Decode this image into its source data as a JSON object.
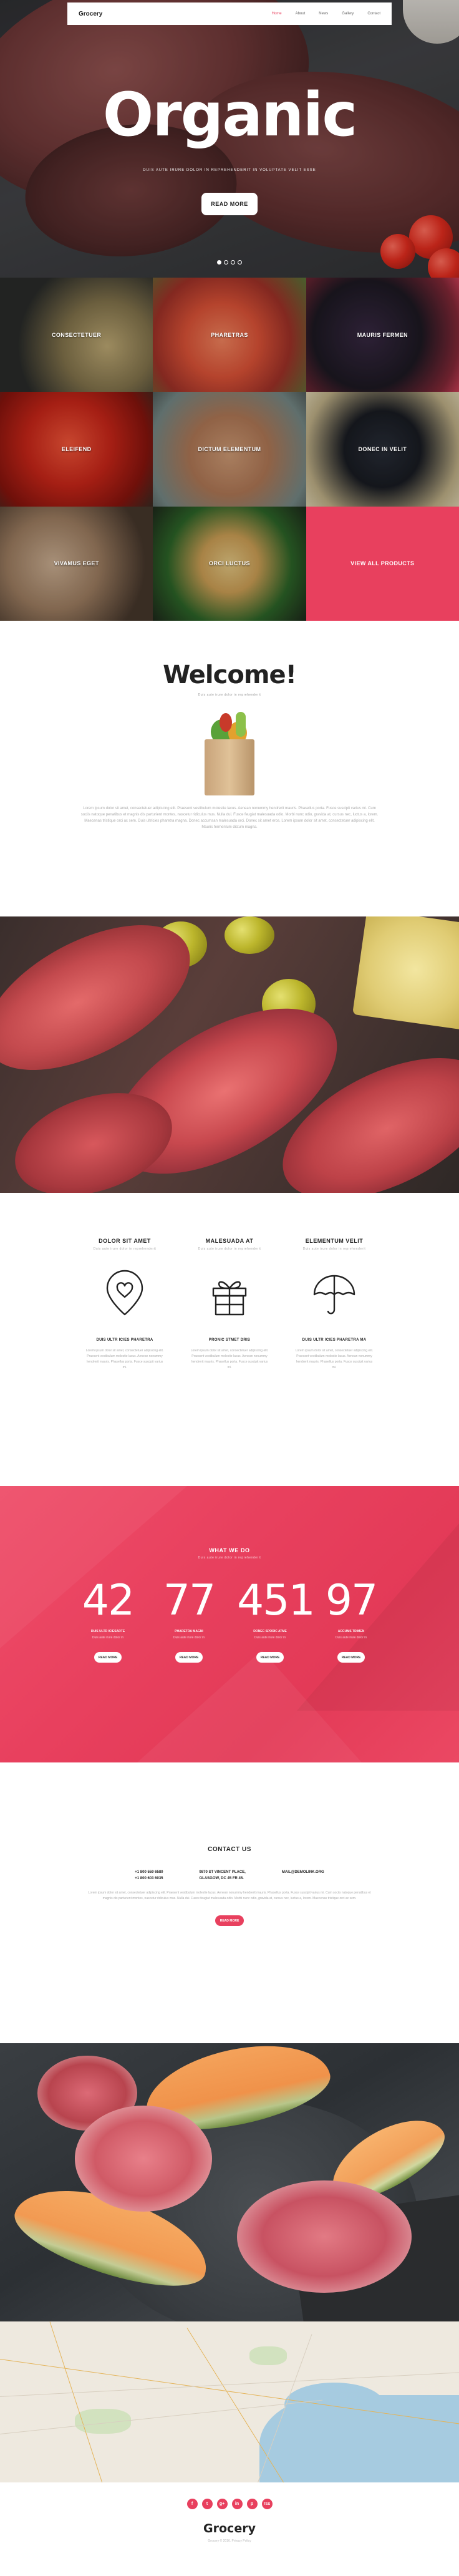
{
  "header": {
    "brand": "Grocery",
    "nav": [
      "Home",
      "About",
      "News",
      "Gallery",
      "Contact"
    ]
  },
  "hero": {
    "title": "Organic",
    "subtitle": "DUIS AUTE IRURE DOLOR IN REPREHENDERIT IN VOLUPTATE VELIT ESSE",
    "button": "READ MORE",
    "slide_count": 4,
    "active_slide": 1
  },
  "categories": [
    "CONSECTETUER",
    "PHARETRAS",
    "MAURIS FERMEN",
    "ELEIFEND",
    "DICTUM ELEMENTUM",
    "DONEC IN VELIT",
    "VIVAMUS EGET",
    "ORCI LUCTUS",
    "VIEW ALL PRODUCTS"
  ],
  "welcome": {
    "title": "Welcome!",
    "tagline": "Duis aute irure dolor in reprehenderit",
    "text": "Lorem ipsum dolor sit amet, consectetuer adipiscing elit. Praesent vestibulum molestie lacus. Aenean nonummy hendrerit mauris. Phasellus porta. Fusce suscipit varius mi. Cum sociis natoque penatibus et magnis dis parturient montes, nascetur ridiculus mus. Nulla dui. Fusce feugiat malesuada odio. Morbi nunc odio, gravida at, cursus nec, luctus a, lorem. Maecenas tristique orci ac sem. Duis ultricies pharetra magna. Donec accumsan malesuada orci. Donec sit amet eros. Lorem ipsum dolor sit amet, consectetuer adipiscing elit. Mauris fermentum dictum magna."
  },
  "features": [
    {
      "title": "DOLOR SIT AMET",
      "tagline": "Duis aute irure dolor in reprehenderit",
      "icon": "map-pin-heart-icon",
      "subtitle": "DUIS ULTR ICIES PHARETRA",
      "text": "Lorem ipsum dolor sit amet, consectetuer adipiscing elit. Praesent vestibulum molestie lacus. Aenean nonummy hendrerit mauris. Phasellus porta. Fusce suscipit varius mi."
    },
    {
      "title": "MALESUADA AT",
      "tagline": "Duis aute irure dolor in reprehenderit",
      "icon": "gift-icon",
      "subtitle": "PRONIC STMET DRIS",
      "text": "Lorem ipsum dolor sit amet, consectetuer adipiscing elit. Praesent vestibulum molestie lacus. Aenean nonummy hendrerit mauris. Phasellus porta. Fusce suscipit varius mi."
    },
    {
      "title": "ELEMENTUM VELIT",
      "tagline": "Duis aute irure dolor in reprehenderit",
      "icon": "umbrella-icon",
      "subtitle": "DUIS ULTR ICIES PHARETRA MA",
      "text": "Lorem ipsum dolor sit amet, consectetuer adipiscing elit. Praesent vestibulum molestie lacus. Aenean nonummy hendrerit mauris. Phasellus porta. Fusce suscipit varius mi."
    }
  ],
  "stats": {
    "title": "WHAT WE DO",
    "tagline": "Duis aute irure dolor in reprehenderit",
    "items": [
      {
        "number": "42",
        "label": "DUIS ULTR ICIESARTE",
        "sub": "Duis aute irure dolor in",
        "button": "READ MORE"
      },
      {
        "number": "77",
        "label": "PHARETRA MAGNI",
        "sub": "Duis aute irure dolor in",
        "button": "READ MORE"
      },
      {
        "number": "451",
        "label": "DONEC SPORIC ATME",
        "sub": "Duis aute irure dolor in",
        "button": "READ MORE"
      },
      {
        "number": "97",
        "label": "ACCUMS TRIMEN",
        "sub": "Duis aute irure dolor in",
        "button": "READ MORE"
      }
    ]
  },
  "contact": {
    "title": "CONTACT US",
    "phones": [
      "+1 800 559 6580",
      "+1 800 603 6035"
    ],
    "address": [
      "9870 ST VINCENT PLACE,",
      "GLASGOW, DC 45 FR 45."
    ],
    "email": "MAIL@DEMOLINK.ORG",
    "text": "Lorem ipsum dolor sit amet, consectetuer adipiscing elit. Praesent vestibulum molestie lacus. Aenean nonummy hendrerit mauris. Phasellus porta. Fusce suscipit varius mi. Cum sociis natoque penatibus et magnis dis parturient montes, nascetur ridiculus mus. Nulla dui. Fusce feugiat malesuada odio. Morbi nunc odio, gravida at, cursus nec, luctus a, lorem. Maecenas tristique orci ac sem.",
    "button": "READ MORE"
  },
  "footer": {
    "social": [
      "f",
      "t",
      "g+",
      "in",
      "p",
      "rss"
    ],
    "brand": "Grocery",
    "copyright": "Grocery © 2016. Privacy Policy"
  },
  "colors": {
    "accent": "#e8405e",
    "text_dark": "#222222",
    "text_muted": "#aaaaaa"
  }
}
